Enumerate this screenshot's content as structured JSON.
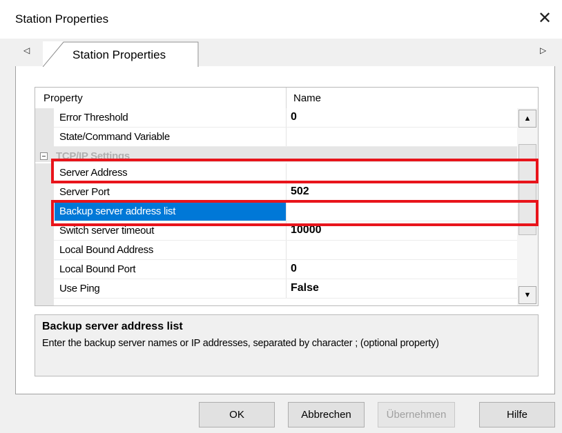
{
  "window": {
    "title": "Station Properties"
  },
  "tabs": [
    {
      "label": "Station Properties"
    }
  ],
  "grid": {
    "header": {
      "property": "Property",
      "name": "Name"
    },
    "rows": [
      {
        "label": "Error Threshold",
        "value": "0"
      },
      {
        "label": "State/Command Variable",
        "value": ""
      },
      {
        "label": "TCP/IP Settings",
        "value": "",
        "category": true
      },
      {
        "label": "Server Address",
        "value": ""
      },
      {
        "label": "Server Port",
        "value": "502"
      },
      {
        "label": "Backup server address list",
        "value": "",
        "selected": true
      },
      {
        "label": "Switch server timeout",
        "value": "10000"
      },
      {
        "label": "Local Bound Address",
        "value": ""
      },
      {
        "label": "Local Bound Port",
        "value": "0"
      },
      {
        "label": "Use Ping",
        "value": "False"
      }
    ]
  },
  "description": {
    "title": "Backup server address list",
    "text": "Enter the backup server names or IP addresses, separated by character ; (optional property)"
  },
  "buttons": {
    "ok": "OK",
    "cancel": "Abbrechen",
    "apply": "Übernehmen",
    "help": "Hilfe"
  },
  "colors": {
    "selection": "#0078d7",
    "highlight_box": "#e8141b"
  },
  "icons": {
    "close": "close-icon",
    "tab_left": "chevron-left-icon",
    "tab_right": "chevron-right-icon",
    "collapse": "collapse-minus-icon"
  }
}
